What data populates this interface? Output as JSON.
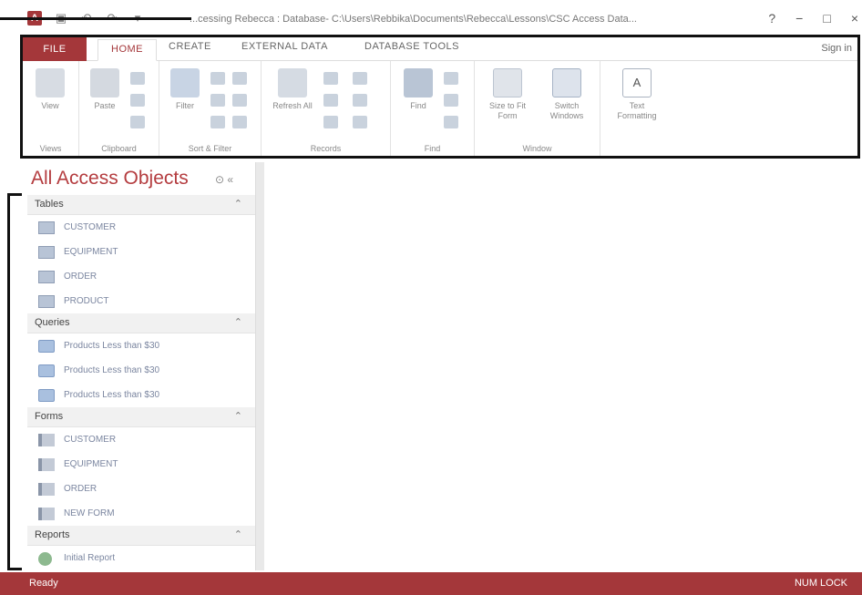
{
  "window": {
    "title": "...cessing Rebecca : Database- C:\\Users\\Rebbika\\Documents\\Rebecca\\Lessons\\CSC Access Data...",
    "controls": [
      "?",
      "−",
      "□",
      "×"
    ]
  },
  "ribbon": {
    "tabs": [
      "FILE",
      "HOME",
      "CREATE",
      "EXTERNAL DATA",
      "DATABASE TOOLS"
    ],
    "sign_in": "Sign in",
    "groups": [
      {
        "label": "Views",
        "buttons": [
          "View"
        ]
      },
      {
        "label": "Clipboard",
        "buttons": [
          "Paste"
        ]
      },
      {
        "label": "Sort & Filter",
        "buttons": [
          "Filter"
        ]
      },
      {
        "label": "Records",
        "buttons": [
          "Refresh All"
        ]
      },
      {
        "label": "Find",
        "buttons": [
          "Find"
        ]
      },
      {
        "label": "Window",
        "buttons": [
          "Size to Fit Form",
          "Switch Windows"
        ]
      },
      {
        "label": "",
        "buttons": [
          "Text Formatting"
        ]
      }
    ]
  },
  "nav": {
    "title": "All Access Objects",
    "sections": [
      {
        "label": "Tables",
        "items": [
          "CUSTOMER",
          "EQUIPMENT",
          "ORDER",
          "PRODUCT"
        ],
        "icon": "table"
      },
      {
        "label": "Queries",
        "items": [
          "Products Less than $30",
          "Products Less than $30",
          "Products Less than $30"
        ],
        "icon": "query"
      },
      {
        "label": "Forms",
        "items": [
          "CUSTOMER",
          "EQUIPMENT",
          "ORDER",
          "NEW FORM"
        ],
        "icon": "form"
      },
      {
        "label": "Reports",
        "items": [
          "Initial Report"
        ],
        "icon": "report"
      }
    ]
  },
  "status": {
    "left": "Ready",
    "right": "NUM LOCK"
  },
  "colors": {
    "accent": "#a4373a",
    "nav_title": "#b43c3f"
  }
}
